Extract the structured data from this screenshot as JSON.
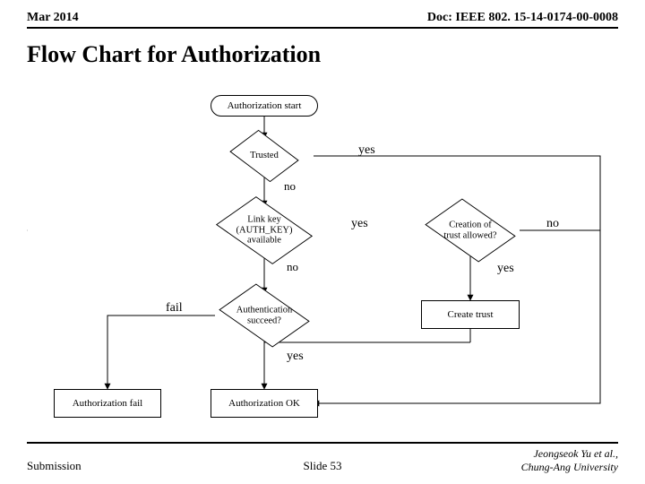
{
  "header": {
    "date": "Mar 2014",
    "doc": "Doc: IEEE 802. 15-14-0174-00-0008"
  },
  "title": "Flow Chart for Authorization",
  "nodes": {
    "start": "Authorization start",
    "trusted": "Trusted",
    "linkkey": "Link key\n(AUTH_KEY)\navailable",
    "trustallowed": "Creation of\ntrust allowed?",
    "authsucc": "Authentication\nsucceed?",
    "createtrust": "Create trust",
    "authok": "Authorization OK",
    "authfail": "Authorization fail"
  },
  "edge": {
    "yes1": "yes",
    "no1": "no",
    "yes2": "yes",
    "no2": "no",
    "yes3": "yes",
    "no3": "no",
    "yes4": "yes",
    "fail": "fail"
  },
  "footer": {
    "left": "Submission",
    "center": "Slide 53",
    "right1": "Jeongseok Yu et al.,",
    "right2": "Chung-Ang University"
  }
}
